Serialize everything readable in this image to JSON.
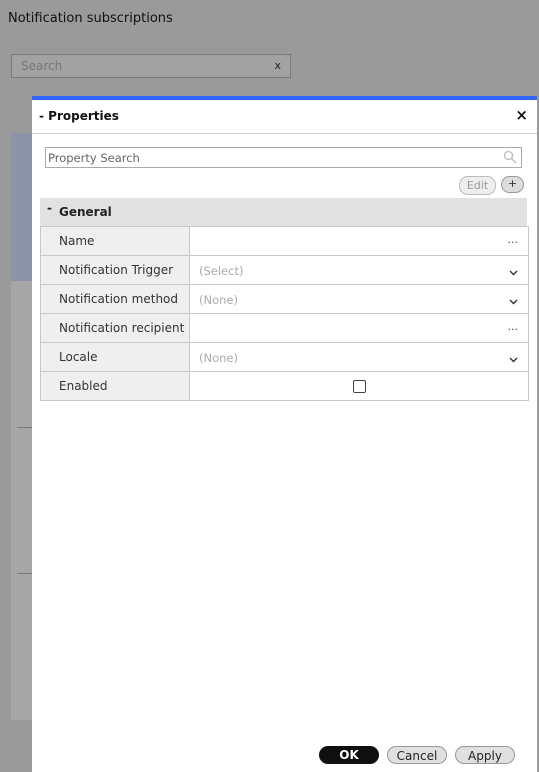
{
  "page": {
    "title": "Notification subscriptions",
    "search_placeholder": "Search",
    "search_clear": "x"
  },
  "dialog": {
    "title": "- Properties",
    "close": "×",
    "property_search_placeholder": "Property Search",
    "edit_label": "Edit",
    "add_label": "+",
    "group": {
      "toggle": "-",
      "label": "General"
    },
    "rows": [
      {
        "name": "Name",
        "value": "",
        "control": "ellipsis",
        "control_text": "..."
      },
      {
        "name": "Notification Trigger",
        "value": "(Select)",
        "control": "dropdown"
      },
      {
        "name": "Notification method",
        "value": "(None)",
        "control": "dropdown"
      },
      {
        "name": "Notification recipient",
        "value": "",
        "control": "ellipsis",
        "control_text": "..."
      },
      {
        "name": "Locale",
        "value": "(None)",
        "control": "dropdown"
      },
      {
        "name": "Enabled",
        "value": "",
        "control": "checkbox",
        "checked": false
      }
    ],
    "buttons": {
      "ok": "OK",
      "cancel": "Cancel",
      "apply": "Apply"
    }
  },
  "colors": {
    "accent": "#3366ff",
    "overlay": "#9a9a9a"
  }
}
